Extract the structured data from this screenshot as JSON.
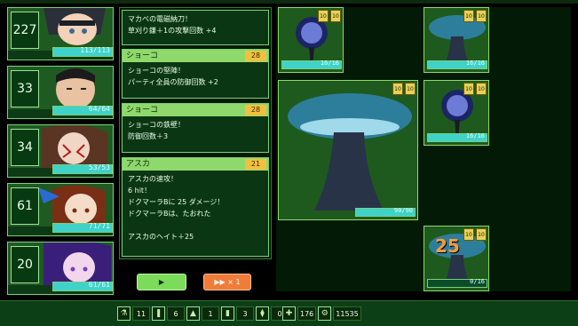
{
  "party": [
    {
      "ct": "227",
      "hp_text": "113/113",
      "hp": 1.0
    },
    {
      "ct": "33",
      "hp_text": "64/64",
      "hp": 1.0
    },
    {
      "ct": "34",
      "hp_text": "53/53",
      "hp": 1.0
    },
    {
      "ct": "61",
      "hp_text": "71/71",
      "hp": 1.0
    },
    {
      "ct": "20",
      "hp_text": "61/61",
      "hp": 1.0
    }
  ],
  "log": [
    {
      "name": "",
      "num": "",
      "lines": [
        "マカベの電磁納刀！",
        "草刈り鎌＋1の攻撃回数 +4"
      ]
    },
    {
      "name": "ショーコ",
      "num": "28",
      "lines": [
        "ショーコの堅陣！",
        "パーティ全員の防御回数 +2"
      ]
    },
    {
      "name": "ショーコ",
      "num": "28",
      "lines": [
        "ショーコの鉄壁！",
        "防御回数＋3"
      ]
    },
    {
      "name": "アスカ",
      "num": "21",
      "lines": [
        "アスカの速攻！",
        "6 hit！",
        "ドクマーラBに 25 ダメージ！",
        "ドクマーラBは、たおれた",
        "",
        "アスカのヘイト＋25"
      ]
    }
  ],
  "buttons": {
    "play": "▶",
    "ff": "▶▶ × 1"
  },
  "enemies": [
    {
      "hp_text": "16/16",
      "hp": 1.0,
      "stats": [
        "10",
        "10"
      ]
    },
    {
      "hp_text": "16/16",
      "hp": 1.0,
      "stats": [
        "10",
        "10"
      ]
    },
    {
      "hp_text": "90/90",
      "hp": 1.0,
      "stats": [
        "10",
        "10"
      ]
    },
    {
      "hp_text": "16/16",
      "hp": 1.0,
      "stats": [
        "10",
        "10"
      ]
    },
    {
      "hp_text": "0/16",
      "hp": 0.0,
      "stats": [
        "10",
        "10"
      ],
      "damage": "25"
    }
  ],
  "inventory": [
    {
      "icon": "potion-icon",
      "glyph": "⚗",
      "count": "11"
    },
    {
      "icon": "bottle-icon",
      "glyph": "❚",
      "count": "6"
    },
    {
      "icon": "lamp-icon",
      "glyph": "▲",
      "count": "1"
    },
    {
      "icon": "battery-icon",
      "glyph": "▮",
      "count": "3"
    },
    {
      "icon": "vial-icon",
      "glyph": "⧫",
      "count": "0"
    }
  ],
  "resources": [
    {
      "icon": "kit-icon",
      "glyph": "✚",
      "count": "176"
    },
    {
      "icon": "gear-icon",
      "glyph": "⚙",
      "count": "11535"
    }
  ]
}
